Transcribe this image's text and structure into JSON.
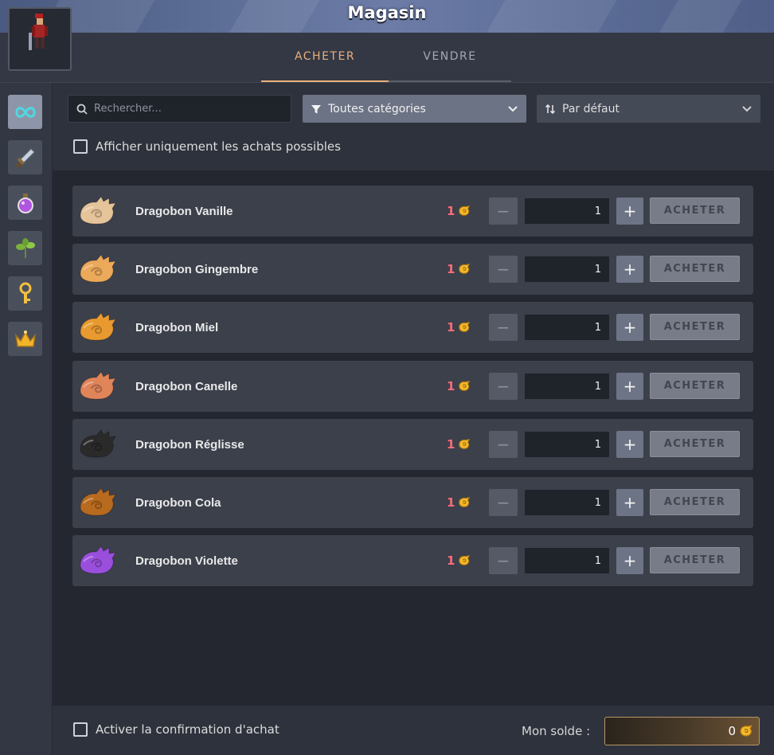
{
  "window": {
    "title": "Magasin"
  },
  "tabs": [
    {
      "label": "ACHETER",
      "active": true
    },
    {
      "label": "VENDRE",
      "active": false
    }
  ],
  "sidebar": {
    "categories": [
      {
        "icon": "infinity-icon",
        "active": true
      },
      {
        "icon": "sword-icon",
        "active": false
      },
      {
        "icon": "potion-icon",
        "active": false
      },
      {
        "icon": "plant-icon",
        "active": false
      },
      {
        "icon": "key-icon",
        "active": false
      },
      {
        "icon": "crown-icon",
        "active": false
      }
    ]
  },
  "filters": {
    "search_placeholder": "Rechercher...",
    "category_selected": "Toutes catégories",
    "sort_selected": "Par défaut",
    "only_affordable_label": "Afficher uniquement les achats possibles"
  },
  "items": [
    {
      "name": "Dragobon Vanille",
      "price": "1",
      "quantity": "1",
      "buy_label": "ACHETER",
      "color": "#e6c49a"
    },
    {
      "name": "Dragobon Gingembre",
      "price": "1",
      "quantity": "1",
      "buy_label": "ACHETER",
      "color": "#eba95a"
    },
    {
      "name": "Dragobon Miel",
      "price": "1",
      "quantity": "1",
      "buy_label": "ACHETER",
      "color": "#e89a30"
    },
    {
      "name": "Dragobon Canelle",
      "price": "1",
      "quantity": "1",
      "buy_label": "ACHETER",
      "color": "#e0845a"
    },
    {
      "name": "Dragobon Réglisse",
      "price": "1",
      "quantity": "1",
      "buy_label": "ACHETER",
      "color": "#2a2a2a"
    },
    {
      "name": "Dragobon Cola",
      "price": "1",
      "quantity": "1",
      "buy_label": "ACHETER",
      "color": "#b86a1e"
    },
    {
      "name": "Dragobon Violette",
      "price": "1",
      "quantity": "1",
      "buy_label": "ACHETER",
      "color": "#9a4fdc"
    }
  ],
  "footer": {
    "confirm_label": "Activer la confirmation d'achat",
    "balance_label": "Mon solde :",
    "balance_value": "0"
  },
  "colors": {
    "accent": "#e9b07a",
    "price": "#ff6b7a",
    "coin": "#f5b82a"
  }
}
